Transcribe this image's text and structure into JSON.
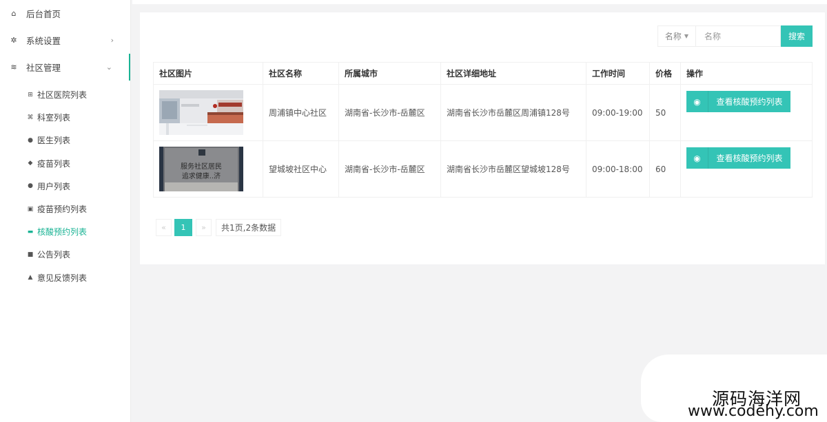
{
  "sidebar": {
    "top": [
      {
        "label": "后台首页",
        "icon": "home-icon",
        "glyph": "⌂"
      },
      {
        "label": "系统设置",
        "icon": "gear-icon",
        "glyph": "✲",
        "chevron": "›"
      },
      {
        "label": "社区管理",
        "icon": "layers-icon",
        "glyph": "≋",
        "chevron": "⌄"
      }
    ],
    "sub": [
      {
        "label": "社区医院列表",
        "icon": "hospital-icon",
        "glyph": "⊞"
      },
      {
        "label": "科室列表",
        "icon": "command-icon",
        "glyph": "⌘"
      },
      {
        "label": "医生列表",
        "icon": "user-circle-icon",
        "glyph": "●"
      },
      {
        "label": "疫苗列表",
        "icon": "pill-icon",
        "glyph": "◆"
      },
      {
        "label": "用户列表",
        "icon": "user-circle-icon",
        "glyph": "●"
      },
      {
        "label": "疫苗预约列表",
        "icon": "calendar-icon",
        "glyph": "▣"
      },
      {
        "label": "核酸预约列表",
        "icon": "id-card-icon",
        "glyph": "▬"
      },
      {
        "label": "公告列表",
        "icon": "notice-icon",
        "glyph": "■"
      },
      {
        "label": "意见反馈列表",
        "icon": "warning-icon",
        "glyph": "▲"
      }
    ]
  },
  "search": {
    "field_label": "名称",
    "placeholder": "名称",
    "button": "搜索"
  },
  "table": {
    "headers": [
      "社区图片",
      "社区名称",
      "所属城市",
      "社区详细地址",
      "工作时间",
      "价格",
      "操作"
    ],
    "rows": [
      {
        "name": "周浦镇中心社区",
        "city": "湖南省-长沙市-岳麓区",
        "address": "湖南省长沙市岳麓区周浦镇128号",
        "hours": "09:00-19:00",
        "price": "50",
        "action": "查看核酸预约列表"
      },
      {
        "name": "望城坡社区中心",
        "city": "湖南省-长沙市-岳麓区",
        "address": "湖南省长沙市岳麓区望城坡128号",
        "hours": "09:00-18:00",
        "price": "60",
        "action": "查看核酸预约列表",
        "sign_text": [
          "服务社区居民",
          "追求健康..济"
        ]
      }
    ]
  },
  "pagination": {
    "prev": "«",
    "current": "1",
    "next": "»",
    "info": "共1页,2条数据"
  },
  "watermark": {
    "cn": "源码海洋网",
    "url": "www.codehy.com"
  },
  "colors": {
    "accent": "#34c4b6",
    "active_text": "#1ab394"
  }
}
